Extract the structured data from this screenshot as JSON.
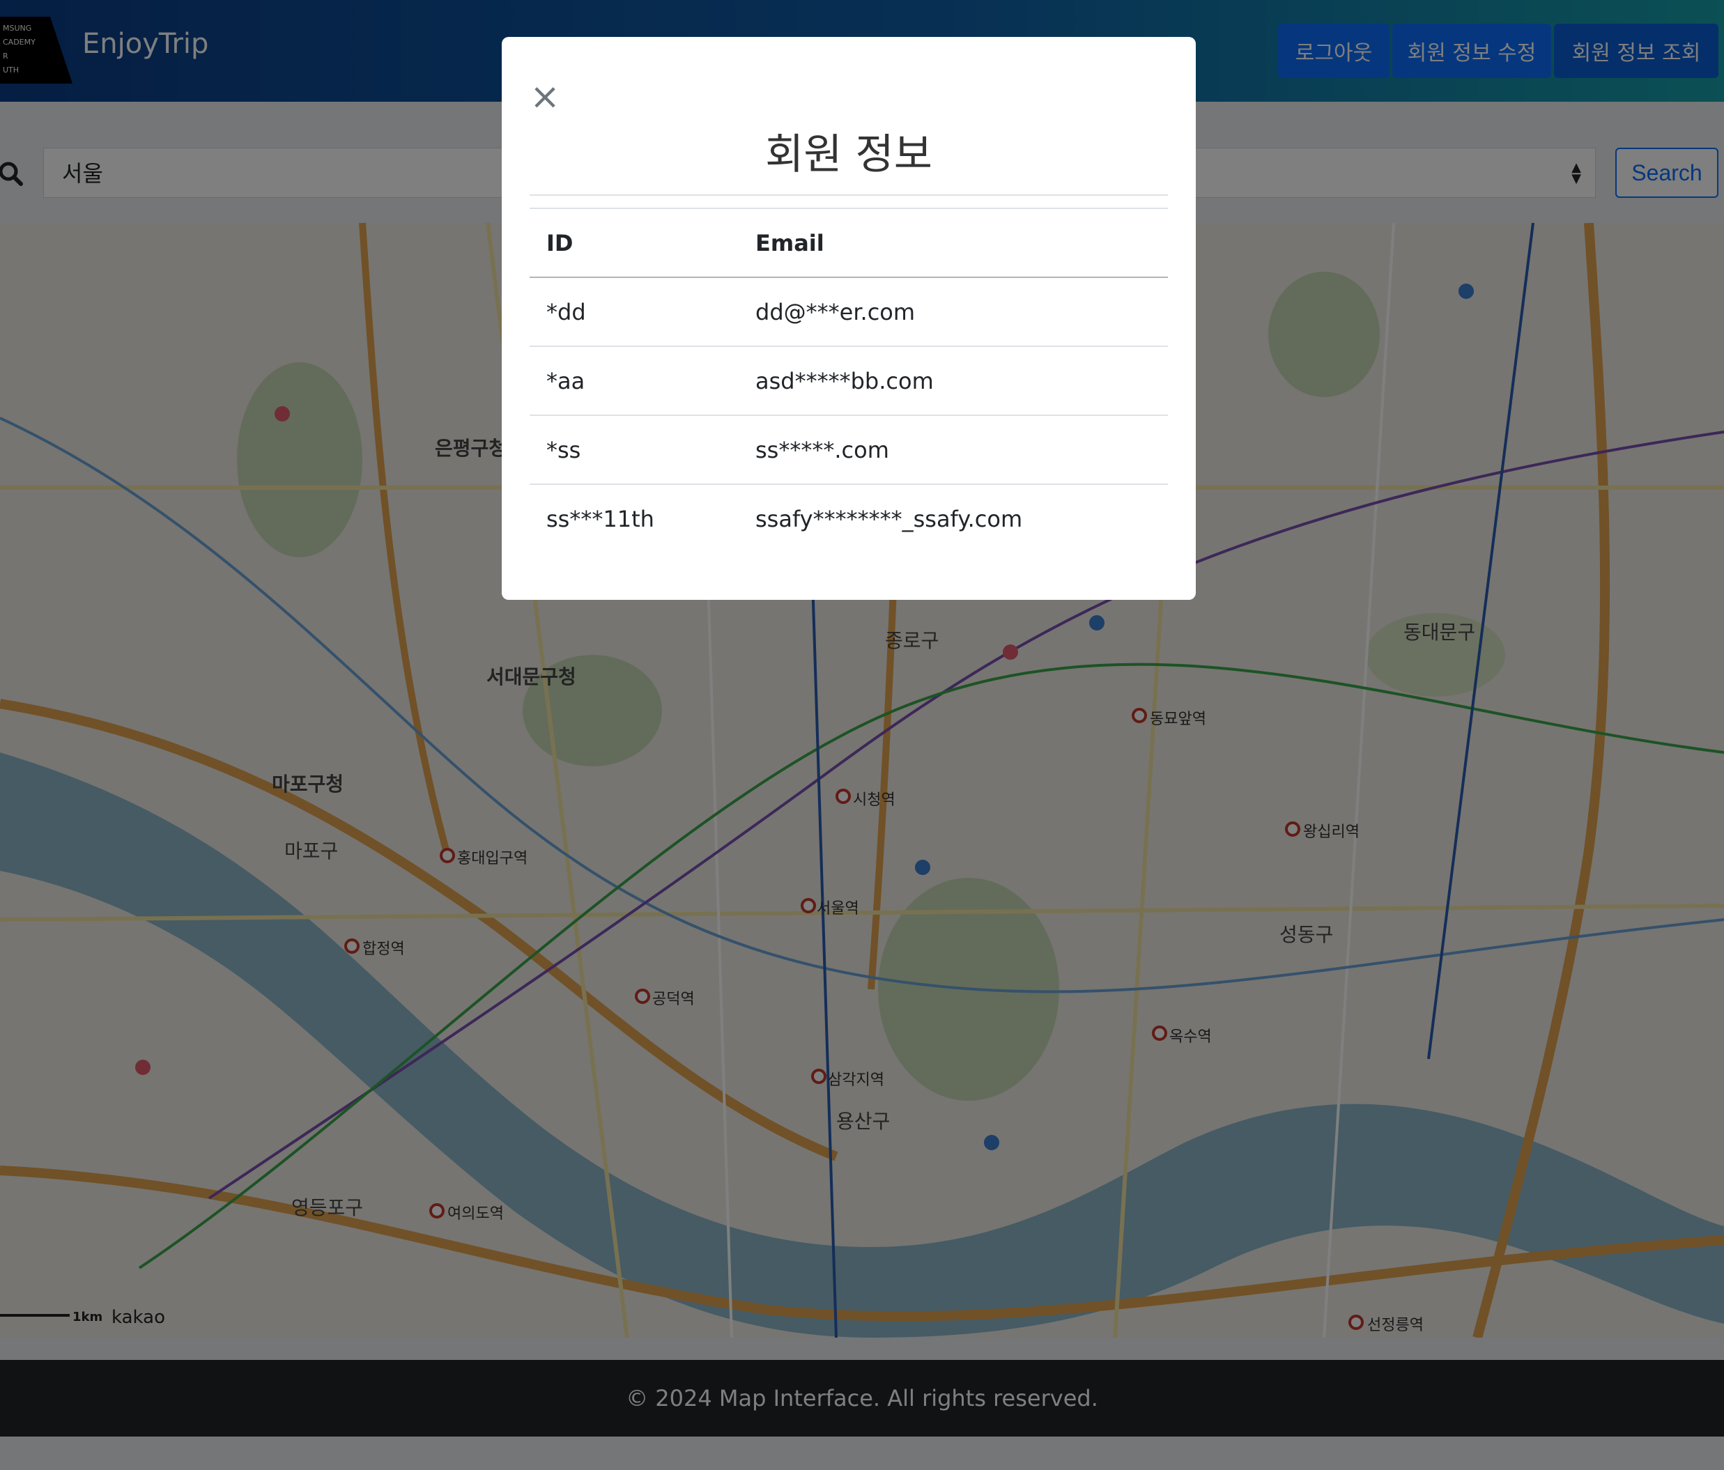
{
  "header": {
    "logo_text": "SAMSUNG SW ACADEMY FOR YOUTH",
    "brand": "EnjoyTrip",
    "buttons": [
      "로그아웃",
      "회원 정보 수정",
      "회원 정보 조회"
    ]
  },
  "search": {
    "query": "서울",
    "button_label": "Search"
  },
  "map": {
    "labels": {
      "eunpyeong": "은평구청",
      "seodaemun": "서대문구청",
      "mapo": "마포구청",
      "mapo_gu": "마포구",
      "jongno": "종로구",
      "yongsan": "용산구",
      "seongdong": "성동구",
      "dongdaemun": "동대문구",
      "yeongdeungpo": "영등포구",
      "seoul_station": "서울역",
      "city_hall": "시청역",
      "hongdae": "홍대입구역",
      "hapjeong": "합정역",
      "gongdeok": "공덕역",
      "samgakji": "삼각지역",
      "wangsimni": "왕십리역",
      "oksu": "옥수역",
      "dongmyo": "동묘앞역",
      "seolleung": "선정릉역",
      "yeouido": "여의도역"
    },
    "scale_text": "1km",
    "attribution": "kakao"
  },
  "footer": {
    "text": "© 2024 Map Interface. All rights reserved."
  },
  "modal": {
    "title": "회원 정보",
    "close_symbol": "×",
    "columns": [
      "ID",
      "Email"
    ],
    "rows": [
      [
        "*dd",
        "dd@***er.com"
      ],
      [
        "*aa",
        "asd*****bb.com"
      ],
      [
        "*ss",
        "ss*****.com"
      ],
      [
        "ss***11th",
        "ssafy********_ssafy.com"
      ]
    ]
  }
}
